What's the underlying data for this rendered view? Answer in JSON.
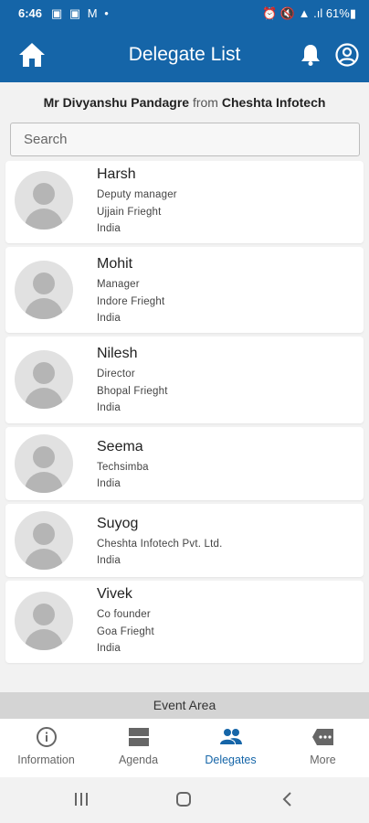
{
  "status_bar": {
    "time": "6:46",
    "notification_glyphs": "▣ ▣ M •",
    "right_text": "⏰ 🔇 ▲ .ıl 61%▮"
  },
  "app_bar": {
    "title": "Delegate List"
  },
  "subtitle": {
    "person": "Mr Divyanshu Pandagre",
    "from": "from",
    "company": "Cheshta Infotech"
  },
  "search": {
    "placeholder": "Search",
    "value": ""
  },
  "delegates": [
    {
      "name": "Harsh",
      "lines": [
        "Deputy manager",
        "Ujjain Frieght",
        "India"
      ]
    },
    {
      "name": "Mohit",
      "lines": [
        "Manager",
        "Indore Frieght",
        "India"
      ]
    },
    {
      "name": "Nilesh",
      "lines": [
        "Director",
        "Bhopal Frieght",
        "India"
      ]
    },
    {
      "name": "Seema",
      "lines": [
        "Techsimba",
        "India"
      ]
    },
    {
      "name": "Suyog",
      "lines": [
        "Cheshta Infotech Pvt. Ltd.",
        "India"
      ]
    },
    {
      "name": "Vivek",
      "lines": [
        "Co founder",
        "Goa Frieght",
        "India"
      ]
    }
  ],
  "event_area": {
    "label": "Event Area"
  },
  "tabs": [
    {
      "label": "Information",
      "icon": "info-icon"
    },
    {
      "label": "Agenda",
      "icon": "agenda-icon"
    },
    {
      "label": "Delegates",
      "icon": "people-icon"
    },
    {
      "label": "More",
      "icon": "more-icon"
    }
  ],
  "active_tab": "Delegates",
  "colors": {
    "primary": "#1565a8",
    "background": "#f2f2f2",
    "tab_inactive": "#666666",
    "event_area_bg": "#d4d4d4"
  }
}
